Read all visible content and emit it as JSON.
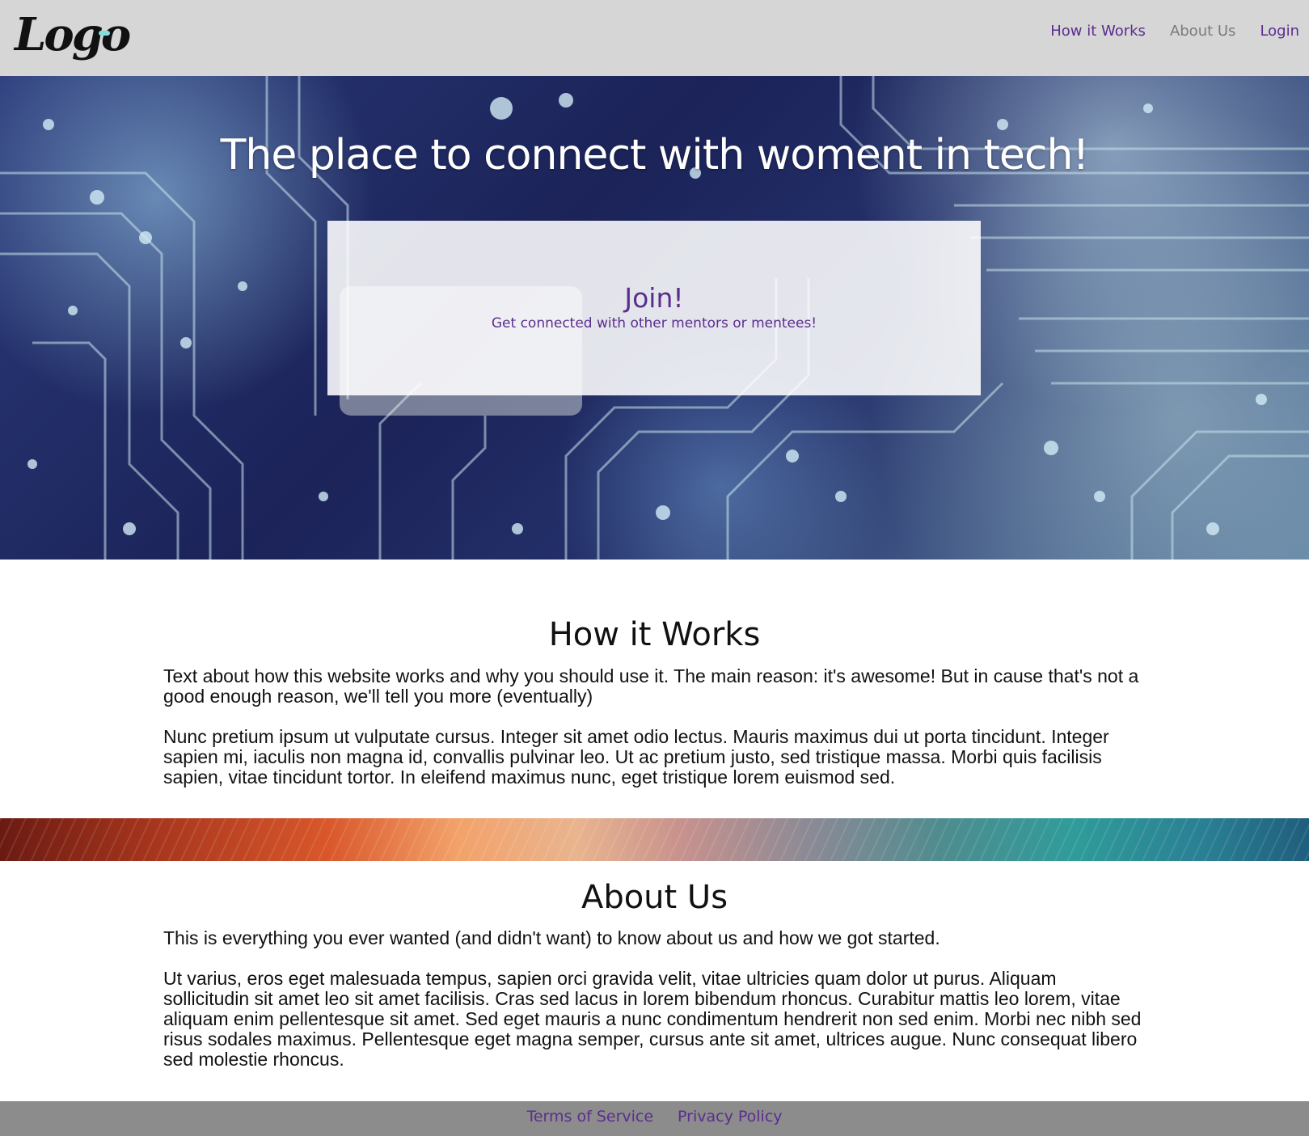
{
  "header": {
    "logo_text": "Logo",
    "nav": [
      {
        "label": "How it Works"
      },
      {
        "label": "About Us"
      },
      {
        "label": "Login"
      }
    ]
  },
  "hero": {
    "title": "The place to connect with woment in tech!",
    "join_title": "Join!",
    "join_subtitle": "Get connected with other mentors or mentees!"
  },
  "how_it_works": {
    "title": "How it Works",
    "paragraphs": [
      "Text about how this website works and why you should use it. The main reason: it's awesome! But in cause that's not a good enough reason, we'll tell you more (eventually)",
      "Nunc pretium ipsum ut vulputate cursus. Integer sit amet odio lectus. Mauris maximus dui ut porta tincidunt. Integer sapien mi, iaculis non magna id, convallis pulvinar leo. Ut ac pretium justo, sed tristique massa. Morbi quis facilisis sapien, vitae tincidunt tortor. In eleifend maximus nunc, eget tristique lorem euismod sed."
    ]
  },
  "about_us": {
    "title": "About Us",
    "paragraphs": [
      "This is everything you ever wanted (and didn't want) to know about us and how we got started.",
      "Ut varius, eros eget malesuada tempus, sapien orci gravida velit, vitae ultricies quam dolor ut purus. Aliquam sollicitudin sit amet leo sit amet facilisis. Cras sed lacus in lorem bibendum rhoncus. Curabitur mattis leo lorem, vitae aliquam enim pellentesque sit amet. Sed eget mauris a nunc condimentum hendrerit non sed enim. Morbi nec nibh sed risus sodales maximus. Pellentesque eget magna semper, cursus ante sit amet, ultrices augue. Nunc consequat libero sed molestie rhoncus."
    ]
  },
  "footer": {
    "links": [
      {
        "label": "Terms of Service"
      },
      {
        "label": "Privacy Policy"
      }
    ]
  },
  "colors": {
    "accent_purple": "#5b2d8e",
    "header_bg": "#d6d6d6",
    "footer_bg": "#8c8c8c"
  }
}
